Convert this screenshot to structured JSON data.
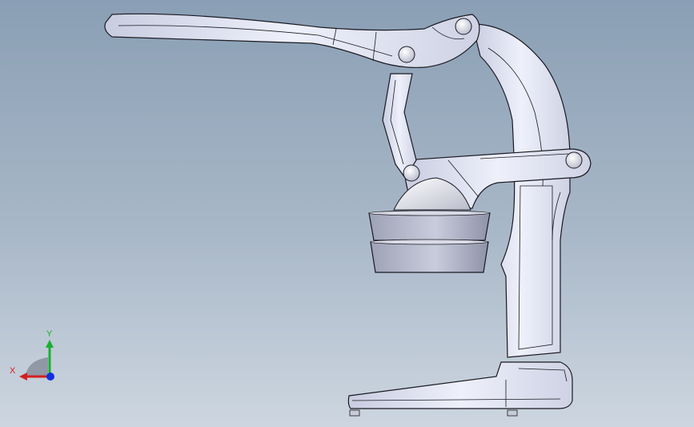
{
  "triad": {
    "x_label": "X",
    "y_label": "Y",
    "x_color": "#d42020",
    "y_color": "#18b030",
    "z_color": "#1030e0"
  },
  "model": {
    "part_color": "#e6e8f6",
    "cup_color": "#b7bbcd",
    "edge_color": "#1a1a22",
    "pivot_color": "#dfe1ee"
  }
}
